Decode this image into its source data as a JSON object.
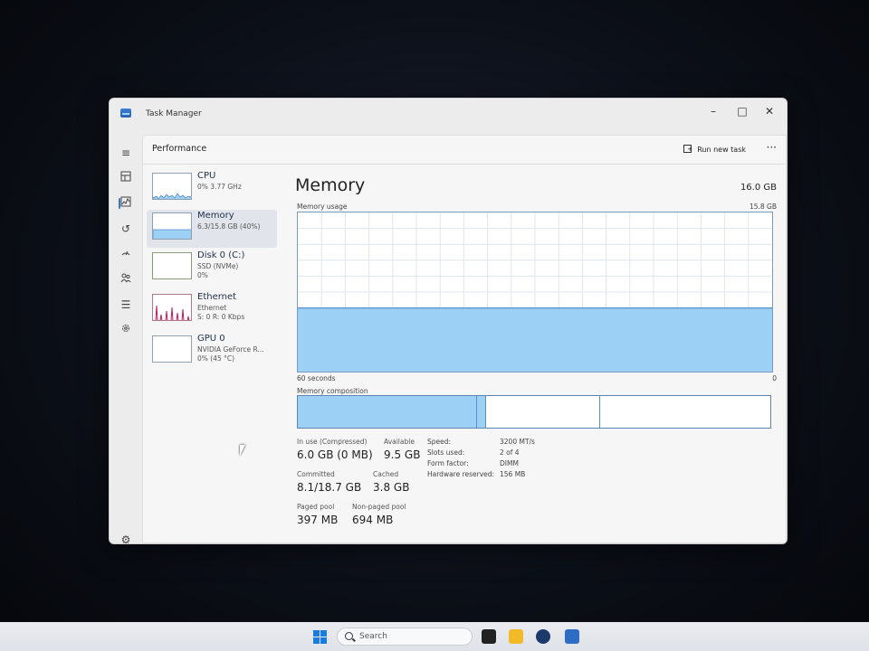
{
  "window": {
    "title": "Task Manager"
  },
  "header": {
    "title": "Performance",
    "run_task_label": "Run new task",
    "more_label": "···"
  },
  "sidebar": {
    "items": [
      {
        "name": "CPU",
        "line1": "0% 3.77 GHz",
        "line2": ""
      },
      {
        "name": "Memory",
        "line1": "6.3/15.8 GB (40%)",
        "line2": ""
      },
      {
        "name": "Disk 0 (C:)",
        "line1": "SSD (NVMe)",
        "line2": "0%"
      },
      {
        "name": "Ethernet",
        "line1": "Ethernet",
        "line2": "S: 0 R: 0 Kbps"
      },
      {
        "name": "GPU 0",
        "line1": "NVIDIA GeForce R...",
        "line2": "0% (45 °C)"
      }
    ]
  },
  "memory": {
    "title": "Memory",
    "total": "16.0 GB",
    "usage_label": "Memory usage",
    "usage_max": "15.8 GB",
    "axis_left": "60 seconds",
    "axis_right": "0",
    "usage_fraction": 0.4,
    "composition_label": "Memory composition",
    "composition": {
      "in_use": 6.0,
      "modified": 0.3,
      "standby": 3.8,
      "free": 5.7,
      "total": 15.8
    },
    "stats": {
      "in_use_label": "In use (Compressed)",
      "in_use_value": "6.0 GB (0 MB)",
      "available_label": "Available",
      "available_value": "9.5 GB",
      "committed_label": "Committed",
      "committed_value": "8.1/18.7 GB",
      "cached_label": "Cached",
      "cached_value": "3.8 GB",
      "paged_label": "Paged pool",
      "paged_value": "397 MB",
      "nonpaged_label": "Non-paged pool",
      "nonpaged_value": "694 MB"
    },
    "details": [
      {
        "key": "Speed:",
        "value": "3200 MT/s"
      },
      {
        "key": "Slots used:",
        "value": "2 of 4"
      },
      {
        "key": "Form factor:",
        "value": "DIMM"
      },
      {
        "key": "Hardware reserved:",
        "value": "156 MB"
      }
    ]
  },
  "taskbar": {
    "search_placeholder": "Search"
  },
  "colors": {
    "memory_fill": "#9cd0f4",
    "memory_line": "#5a8fd0",
    "ethernet": "#c2185b"
  }
}
